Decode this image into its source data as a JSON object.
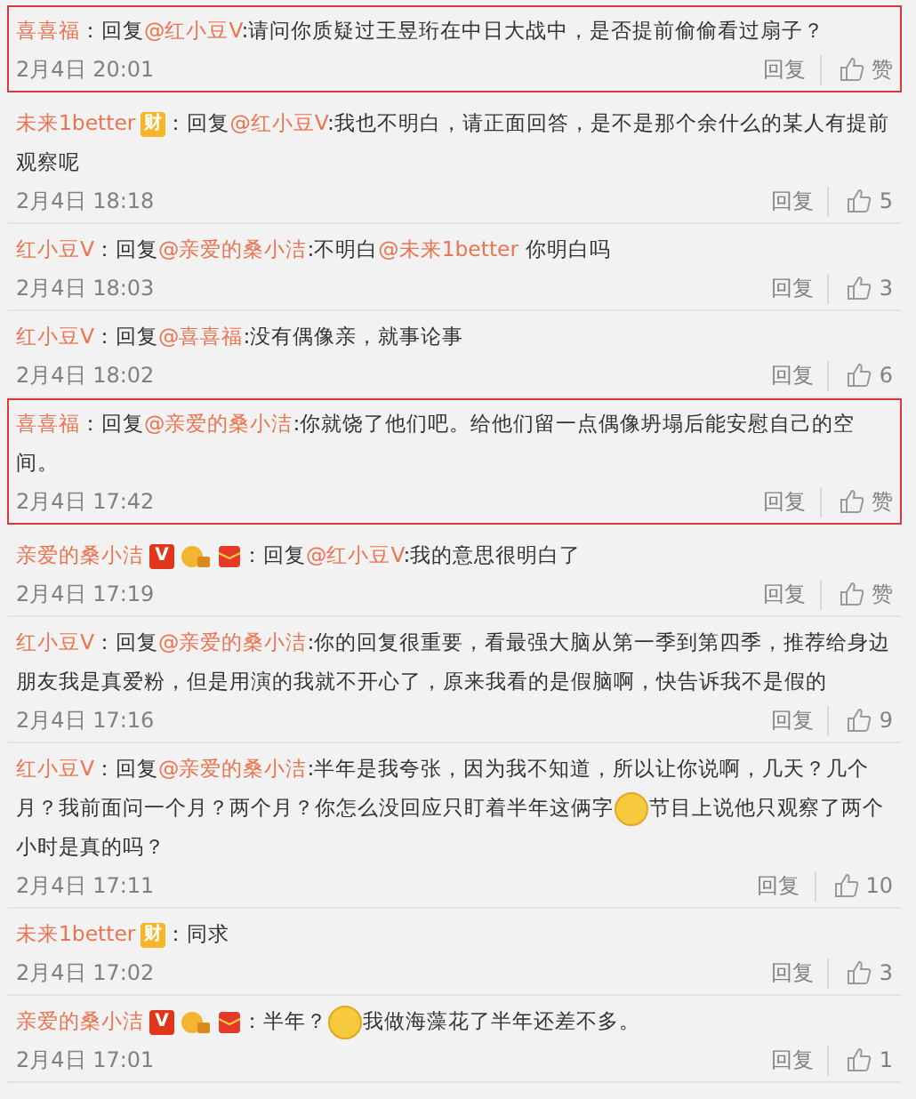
{
  "comments": [
    {
      "user": "喜喜福",
      "highlighted": true,
      "segments": [
        {
          "kind": "text",
          "text": "：回复"
        },
        {
          "kind": "mention",
          "text": "@红小豆V"
        },
        {
          "kind": "text",
          "text": ":请问你质疑过王昱珩在中日大战中，是否提前偷偷看过扇子？"
        }
      ],
      "time": "2月4日 20:01",
      "reply_label": "回复",
      "like_label": "赞"
    },
    {
      "user": "未来1better",
      "badges": [
        {
          "kind": "cai",
          "label": "财"
        }
      ],
      "highlighted": false,
      "segments": [
        {
          "kind": "text",
          "text": "：回复"
        },
        {
          "kind": "mention",
          "text": "@红小豆V"
        },
        {
          "kind": "text",
          "text": ":我也不明白，请正面回答，是不是那个余什么的某人有提前观察呢"
        }
      ],
      "time": "2月4日 18:18",
      "reply_label": "回复",
      "like_label": "5"
    },
    {
      "user": "红小豆V",
      "highlighted": false,
      "segments": [
        {
          "kind": "text",
          "text": "：回复"
        },
        {
          "kind": "mention",
          "text": "@亲爱的桑小洁"
        },
        {
          "kind": "text",
          "text": ":不明白"
        },
        {
          "kind": "mention",
          "text": "@未来1better"
        },
        {
          "kind": "text",
          "text": " 你明白吗"
        }
      ],
      "time": "2月4日 18:03",
      "reply_label": "回复",
      "like_label": "3"
    },
    {
      "user": "红小豆V",
      "highlighted": false,
      "segments": [
        {
          "kind": "text",
          "text": "：回复"
        },
        {
          "kind": "mention",
          "text": "@喜喜福"
        },
        {
          "kind": "text",
          "text": ":没有偶像亲，就事论事"
        }
      ],
      "time": "2月4日 18:02",
      "reply_label": "回复",
      "like_label": "6"
    },
    {
      "user": "喜喜福",
      "highlighted": true,
      "segments": [
        {
          "kind": "text",
          "text": "：回复"
        },
        {
          "kind": "mention",
          "text": "@亲爱的桑小洁"
        },
        {
          "kind": "text",
          "text": ":你就饶了他们吧。给他们留一点偶像坍塌后能安慰自己的空间。"
        }
      ],
      "time": "2月4日 17:42",
      "reply_label": "回复",
      "like_label": "赞"
    },
    {
      "user": "亲爱的桑小洁",
      "badges": [
        {
          "kind": "vip",
          "label": "V"
        },
        {
          "kind": "fan"
        },
        {
          "kind": "redpacket"
        }
      ],
      "highlighted": false,
      "segments": [
        {
          "kind": "text",
          "text": "：回复"
        },
        {
          "kind": "mention",
          "text": "@红小豆V"
        },
        {
          "kind": "text",
          "text": ":我的意思很明白了"
        }
      ],
      "time": "2月4日 17:19",
      "reply_label": "回复",
      "like_label": "赞"
    },
    {
      "user": "红小豆V",
      "highlighted": false,
      "segments": [
        {
          "kind": "text",
          "text": "：回复"
        },
        {
          "kind": "mention",
          "text": "@亲爱的桑小洁"
        },
        {
          "kind": "text",
          "text": ":你的回复很重要，看最强大脑从第一季到第四季，推荐给身边朋友我是真爱粉，但是用演的我就不开心了，原来我看的是假脑啊，快告诉我不是假的"
        }
      ],
      "time": "2月4日 17:16",
      "reply_label": "回复",
      "like_label": "9"
    },
    {
      "user": "红小豆V",
      "highlighted": false,
      "segments": [
        {
          "kind": "text",
          "text": "：回复"
        },
        {
          "kind": "mention",
          "text": "@亲爱的桑小洁"
        },
        {
          "kind": "text",
          "text": ":半年是我夸张，因为我不知道，所以让你说啊，几天？几个月？我前面问一个月？两个月？你怎么没回应只盯着半年这俩字"
        },
        {
          "kind": "emoji"
        },
        {
          "kind": "text",
          "text": "节目上说他只观察了两个小时是真的吗？"
        }
      ],
      "time": "2月4日 17:11",
      "reply_label": "回复",
      "like_label": "10"
    },
    {
      "user": "未来1better",
      "badges": [
        {
          "kind": "cai",
          "label": "财"
        }
      ],
      "highlighted": false,
      "segments": [
        {
          "kind": "text",
          "text": "：同求"
        }
      ],
      "time": "2月4日 17:02",
      "reply_label": "回复",
      "like_label": "3"
    },
    {
      "user": "亲爱的桑小洁",
      "badges": [
        {
          "kind": "vip",
          "label": "V"
        },
        {
          "kind": "fan"
        },
        {
          "kind": "redpacket"
        }
      ],
      "highlighted": false,
      "segments": [
        {
          "kind": "text",
          "text": "：半年？"
        },
        {
          "kind": "emoji"
        },
        {
          "kind": "text",
          "text": "我做海藻花了半年还差不多。"
        }
      ],
      "time": "2月4日 17:01",
      "reply_label": "回复",
      "like_label": "1"
    }
  ]
}
